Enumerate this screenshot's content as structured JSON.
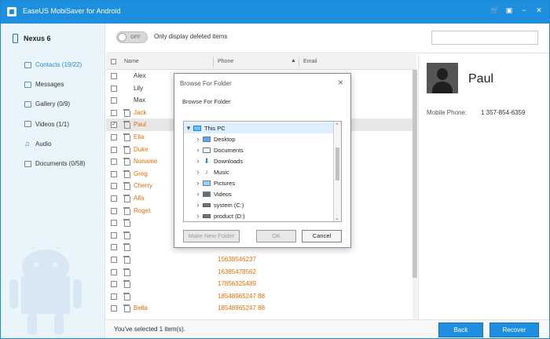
{
  "window": {
    "title": "EaseUS MobiSaver for Android",
    "controls": [
      "cart-icon",
      "shop-icon",
      "minimize-icon",
      "close-icon"
    ]
  },
  "sidebar": {
    "device": "Nexus 6",
    "items": [
      {
        "label": "Contacts (19/22)",
        "icon": "contacts-icon",
        "active": true
      },
      {
        "label": "Messages",
        "icon": "messages-icon"
      },
      {
        "label": "Gallery (0/9)",
        "icon": "gallery-icon"
      },
      {
        "label": "Videos (1/1)",
        "icon": "videos-icon"
      },
      {
        "label": "Audio",
        "icon": "audio-icon"
      },
      {
        "label": "Documents (0/58)",
        "icon": "documents-icon"
      }
    ]
  },
  "toolbar": {
    "toggle_label": "OFF",
    "filter_text": "Only display deleted items"
  },
  "table": {
    "columns": [
      "Name",
      "Phone",
      "Email"
    ],
    "rows": [
      {
        "name": "Alex",
        "phone": "",
        "deleted": false,
        "selected": false,
        "checked": false
      },
      {
        "name": "Lily",
        "phone": "",
        "deleted": false,
        "selected": false,
        "checked": false
      },
      {
        "name": "Max",
        "phone": "",
        "deleted": false,
        "selected": false,
        "checked": false
      },
      {
        "name": "Jack",
        "phone": "",
        "deleted": true,
        "selected": false,
        "checked": false
      },
      {
        "name": "Paul",
        "phone": "",
        "deleted": true,
        "selected": true,
        "checked": true
      },
      {
        "name": "Ella",
        "phone": "",
        "deleted": true,
        "selected": false,
        "checked": false
      },
      {
        "name": "Duke",
        "phone": "",
        "deleted": true,
        "selected": false,
        "checked": false
      },
      {
        "name": "Noname",
        "phone": "",
        "deleted": true,
        "selected": false,
        "checked": false
      },
      {
        "name": "Greg",
        "phone": "",
        "deleted": true,
        "selected": false,
        "checked": false
      },
      {
        "name": "Cherry",
        "phone": "",
        "deleted": true,
        "selected": false,
        "checked": false
      },
      {
        "name": "Alla",
        "phone": "",
        "deleted": true,
        "selected": false,
        "checked": false
      },
      {
        "name": "Roget",
        "phone": "",
        "deleted": true,
        "selected": false,
        "checked": false
      },
      {
        "name": "",
        "phone": "",
        "deleted": true,
        "selected": false,
        "checked": false
      },
      {
        "name": "",
        "phone": "",
        "deleted": true,
        "selected": false,
        "checked": false
      },
      {
        "name": "",
        "phone": "",
        "deleted": true,
        "selected": false,
        "checked": false
      },
      {
        "name": "",
        "phone": "15638546237",
        "deleted": true,
        "selected": false,
        "checked": false
      },
      {
        "name": "",
        "phone": "16385478562",
        "deleted": true,
        "selected": false,
        "checked": false
      },
      {
        "name": "",
        "phone": "17856325489",
        "deleted": true,
        "selected": false,
        "checked": false
      },
      {
        "name": "",
        "phone": "18548965247 88",
        "deleted": true,
        "selected": false,
        "checked": false
      },
      {
        "name": "Bella",
        "phone": "18548965247 88",
        "deleted": true,
        "selected": false,
        "checked": false
      }
    ]
  },
  "detail": {
    "name": "Paul",
    "mobile_label": "Mobile Phone:",
    "mobile_value": "1 357-854-6359"
  },
  "footer": {
    "status": "You've selected 1 item(s).",
    "back_label": "Back",
    "recover_label": "Recover"
  },
  "dialog": {
    "title": "Browse For Folder",
    "instruction": "Browse For Folder",
    "tree": [
      {
        "label": "This PC",
        "icon": "pc-icon",
        "expanded": true,
        "selected": true,
        "indent": 0
      },
      {
        "label": "Desktop",
        "icon": "desktop-folder-icon",
        "expanded": false,
        "selected": false,
        "indent": 1
      },
      {
        "label": "Documents",
        "icon": "documents-folder-icon",
        "expanded": false,
        "selected": false,
        "indent": 1
      },
      {
        "label": "Downloads",
        "icon": "downloads-folder-icon",
        "expanded": false,
        "selected": false,
        "indent": 1
      },
      {
        "label": "Music",
        "icon": "music-folder-icon",
        "expanded": false,
        "selected": false,
        "indent": 1
      },
      {
        "label": "Pictures",
        "icon": "pictures-folder-icon",
        "expanded": false,
        "selected": false,
        "indent": 1
      },
      {
        "label": "Videos",
        "icon": "videos-folder-icon",
        "expanded": false,
        "selected": false,
        "indent": 1
      },
      {
        "label": "system (C:)",
        "icon": "drive-icon",
        "expanded": false,
        "selected": false,
        "indent": 1
      },
      {
        "label": "product (D:)",
        "icon": "drive-icon",
        "expanded": false,
        "selected": false,
        "indent": 1
      }
    ],
    "buttons": {
      "make_new": "Make New Folder",
      "ok": "OK",
      "cancel": "Cancel"
    }
  },
  "colors": {
    "accent": "#1d8fde",
    "deleted": "#e76f00",
    "selected_row": "#e7e7e7"
  }
}
